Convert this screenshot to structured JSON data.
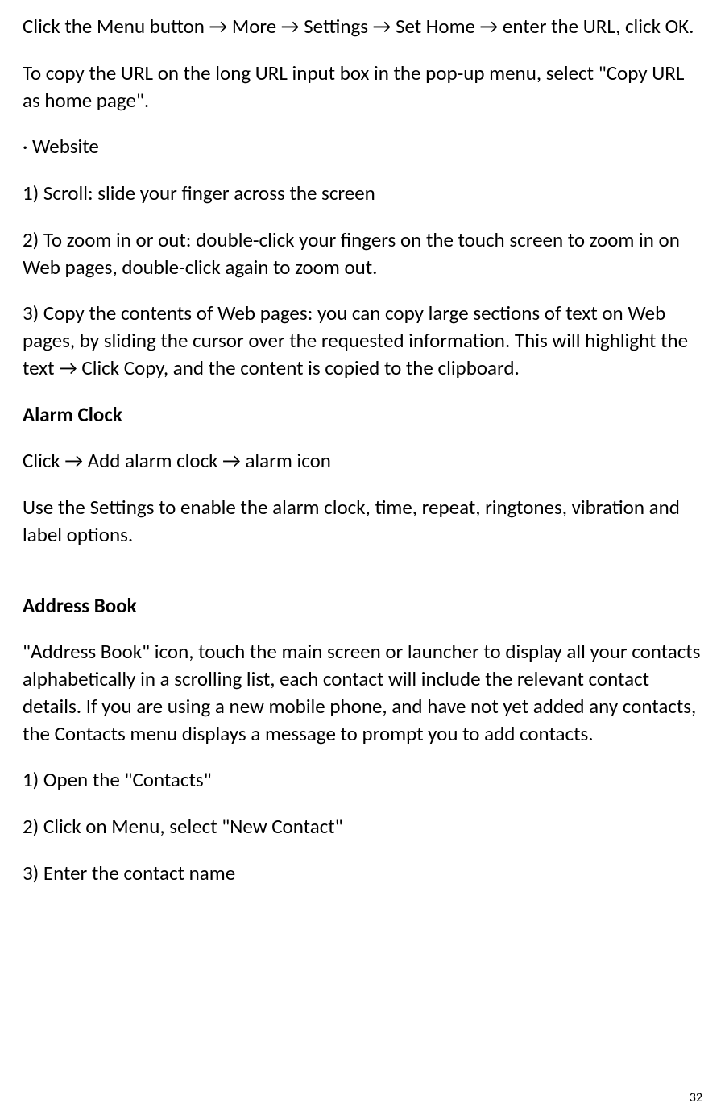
{
  "paragraphs": {
    "p1": "Click the Menu button → More → Settings → Set Home → enter the URL, click OK.",
    "p2": "To copy the URL on the long URL input box in the pop-up menu, select \"Copy URL as home page\".",
    "bullet1": "· Website",
    "p3": "1) Scroll: slide your finger across the screen",
    "p4": "2) To zoom in or out: double-click your fingers on the touch screen to zoom in on Web pages, double-click again to zoom out.",
    "p5": "3) Copy the contents of Web pages: you can copy large sections of text on Web pages, by sliding the cursor over the requested information. This will highlight the text → Click Copy, and the content is copied to the clipboard.",
    "h1": "Alarm Clock",
    "p6": "Click → Add alarm clock → alarm icon",
    "p7": "Use the Settings to enable the alarm clock, time, repeat, ringtones, vibration and label options.",
    "h2": "Address Book",
    "p8": "\"Address Book\" icon, touch the main screen or launcher to display all your contacts alphabetically in a scrolling list, each contact will include the relevant contact details. If you are using a new mobile phone, and have not yet added any contacts, the Contacts menu displays a message to prompt you to add contacts.",
    "p9": "1) Open the \"Contacts\"",
    "p10": "2) Click on Menu, select \"New Contact\"",
    "p11": "3) Enter the contact name"
  },
  "pageNumber": "32"
}
